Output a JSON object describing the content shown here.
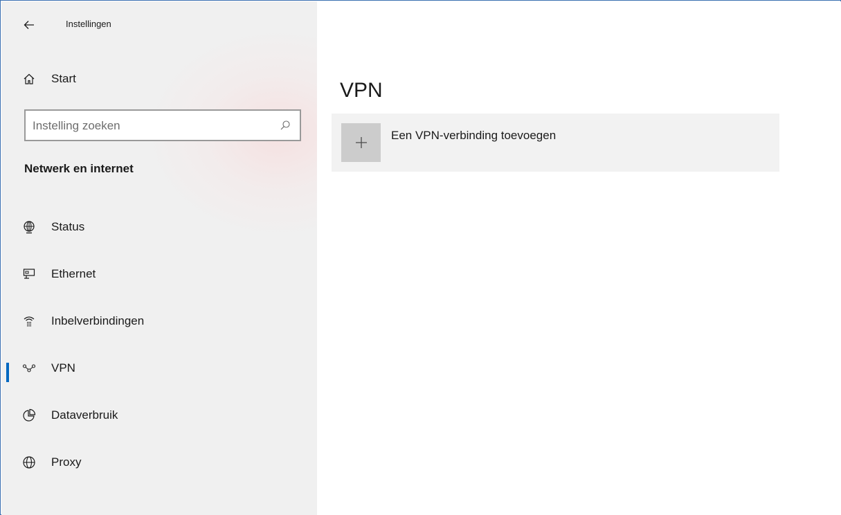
{
  "window": {
    "title": "Instellingen",
    "accent_color": "#0067c0",
    "border_color": "#3a6fb0"
  },
  "header": {
    "back_icon": "arrow-left-icon"
  },
  "sidebar": {
    "home": {
      "label": "Start",
      "icon": "home-icon"
    },
    "search": {
      "placeholder": "Instelling zoeken",
      "value": "",
      "icon": "search-icon"
    },
    "section_title": "Netwerk en internet",
    "items": [
      {
        "label": "Status",
        "icon": "globe-status-icon",
        "selected": false
      },
      {
        "label": "Ethernet",
        "icon": "ethernet-icon",
        "selected": false
      },
      {
        "label": "Inbelverbindingen",
        "icon": "dialup-icon",
        "selected": false
      },
      {
        "label": "VPN",
        "icon": "vpn-icon",
        "selected": true
      },
      {
        "label": "Dataverbruik",
        "icon": "pie-chart-icon",
        "selected": false
      },
      {
        "label": "Proxy",
        "icon": "globe-icon",
        "selected": false
      }
    ]
  },
  "main": {
    "title": "VPN",
    "add_connection": {
      "label": "Een VPN-verbinding toevoegen",
      "icon": "plus-icon"
    }
  }
}
